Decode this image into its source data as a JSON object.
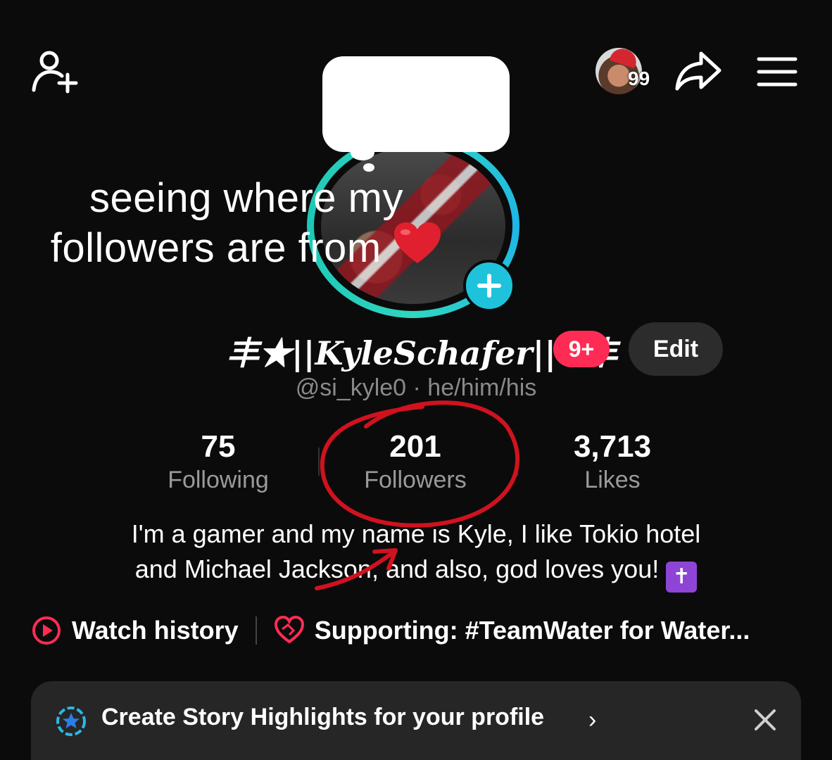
{
  "overlay": {
    "caption_line1": "seeing where my",
    "caption_line2": "followers are from",
    "heart_icon": "red-heart-icon"
  },
  "header": {
    "visitor_count": "99",
    "icons": [
      "add-friend-icon",
      "share-icon",
      "menu-icon"
    ]
  },
  "profile": {
    "display_name": "丰★||KyleSchafer||★丰",
    "notification_badge": "9+",
    "edit_label": "Edit",
    "username": "@si_kyle0 · he/him/his"
  },
  "stats": {
    "following": {
      "value": "75",
      "label": "Following"
    },
    "followers": {
      "value": "201",
      "label": "Followers"
    },
    "likes": {
      "value": "3,713",
      "label": "Likes"
    }
  },
  "bio": {
    "line1": "I'm a gamer and my name is Kyle, I like Tokio hotel",
    "line2": "and Michael Jackson, and also, god loves you!",
    "emoji": "✝"
  },
  "links": {
    "watch_history": "Watch history",
    "supporting": "Supporting: #TeamWater for Water..."
  },
  "banner": {
    "text": "Create Story Highlights for your profile",
    "chevron": "›"
  },
  "colors": {
    "background": "#0b0b0b",
    "accent_pink": "#fe2c55",
    "ring_teal": "#2fd6c0",
    "annotation_red": "#d0121f"
  }
}
